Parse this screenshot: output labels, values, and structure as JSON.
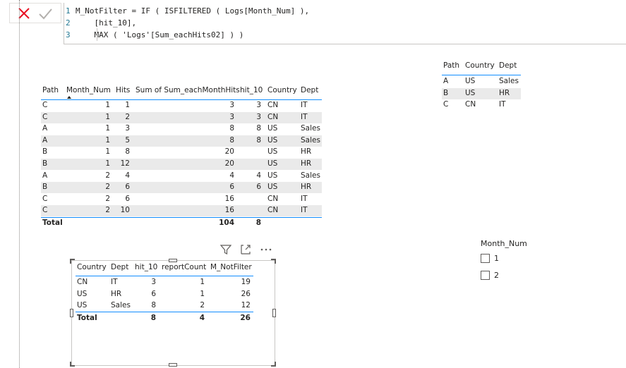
{
  "formula": {
    "lines": [
      {
        "num": "1",
        "text": "M_NotFilter = IF ( ISFILTERED ( Logs[Month_Num] ),"
      },
      {
        "num": "2",
        "text": "    [hit_10],"
      },
      {
        "num": "3",
        "text": "    MAX ( 'Logs'[Sum_eachHits02] ) )"
      }
    ]
  },
  "main_table": {
    "headers": [
      "Path",
      "Month_Num",
      "Hits",
      "Sum of Sum_eachMonthHits",
      "hit_10",
      "Country",
      "Dept"
    ],
    "rows": [
      [
        "C",
        "1",
        "1",
        "3",
        "3",
        "CN",
        "IT"
      ],
      [
        "C",
        "1",
        "2",
        "3",
        "3",
        "CN",
        "IT"
      ],
      [
        "A",
        "1",
        "3",
        "8",
        "8",
        "US",
        "Sales"
      ],
      [
        "A",
        "1",
        "5",
        "8",
        "8",
        "US",
        "Sales"
      ],
      [
        "B",
        "1",
        "8",
        "20",
        "",
        "US",
        "HR"
      ],
      [
        "B",
        "1",
        "12",
        "20",
        "",
        "US",
        "HR"
      ],
      [
        "A",
        "2",
        "4",
        "4",
        "4",
        "US",
        "Sales"
      ],
      [
        "B",
        "2",
        "6",
        "6",
        "6",
        "US",
        "HR"
      ],
      [
        "C",
        "2",
        "6",
        "16",
        "",
        "CN",
        "IT"
      ],
      [
        "C",
        "2",
        "10",
        "16",
        "",
        "CN",
        "IT"
      ]
    ],
    "total": {
      "label": "Total",
      "sum": "104",
      "hit": "8"
    }
  },
  "path_table": {
    "headers": [
      "Path",
      "Country",
      "Dept"
    ],
    "rows": [
      [
        "A",
        "US",
        "Sales"
      ],
      [
        "B",
        "US",
        "HR"
      ],
      [
        "C",
        "CN",
        "IT"
      ]
    ]
  },
  "summary_table": {
    "headers": [
      "Country",
      "Dept",
      "hit_10",
      "reportCount",
      "M_NotFilter"
    ],
    "rows": [
      [
        "CN",
        "IT",
        "3",
        "1",
        "19"
      ],
      [
        "US",
        "HR",
        "6",
        "1",
        "26"
      ],
      [
        "US",
        "Sales",
        "8",
        "2",
        "12"
      ]
    ],
    "total": {
      "label": "Total",
      "hit": "8",
      "count": "4",
      "filter": "26"
    }
  },
  "slicer": {
    "title": "Month_Num",
    "options": [
      "1",
      "2"
    ]
  },
  "colors": {
    "accent": "#118dff",
    "cancel": "#e81123",
    "shade": "#eaeaea"
  }
}
